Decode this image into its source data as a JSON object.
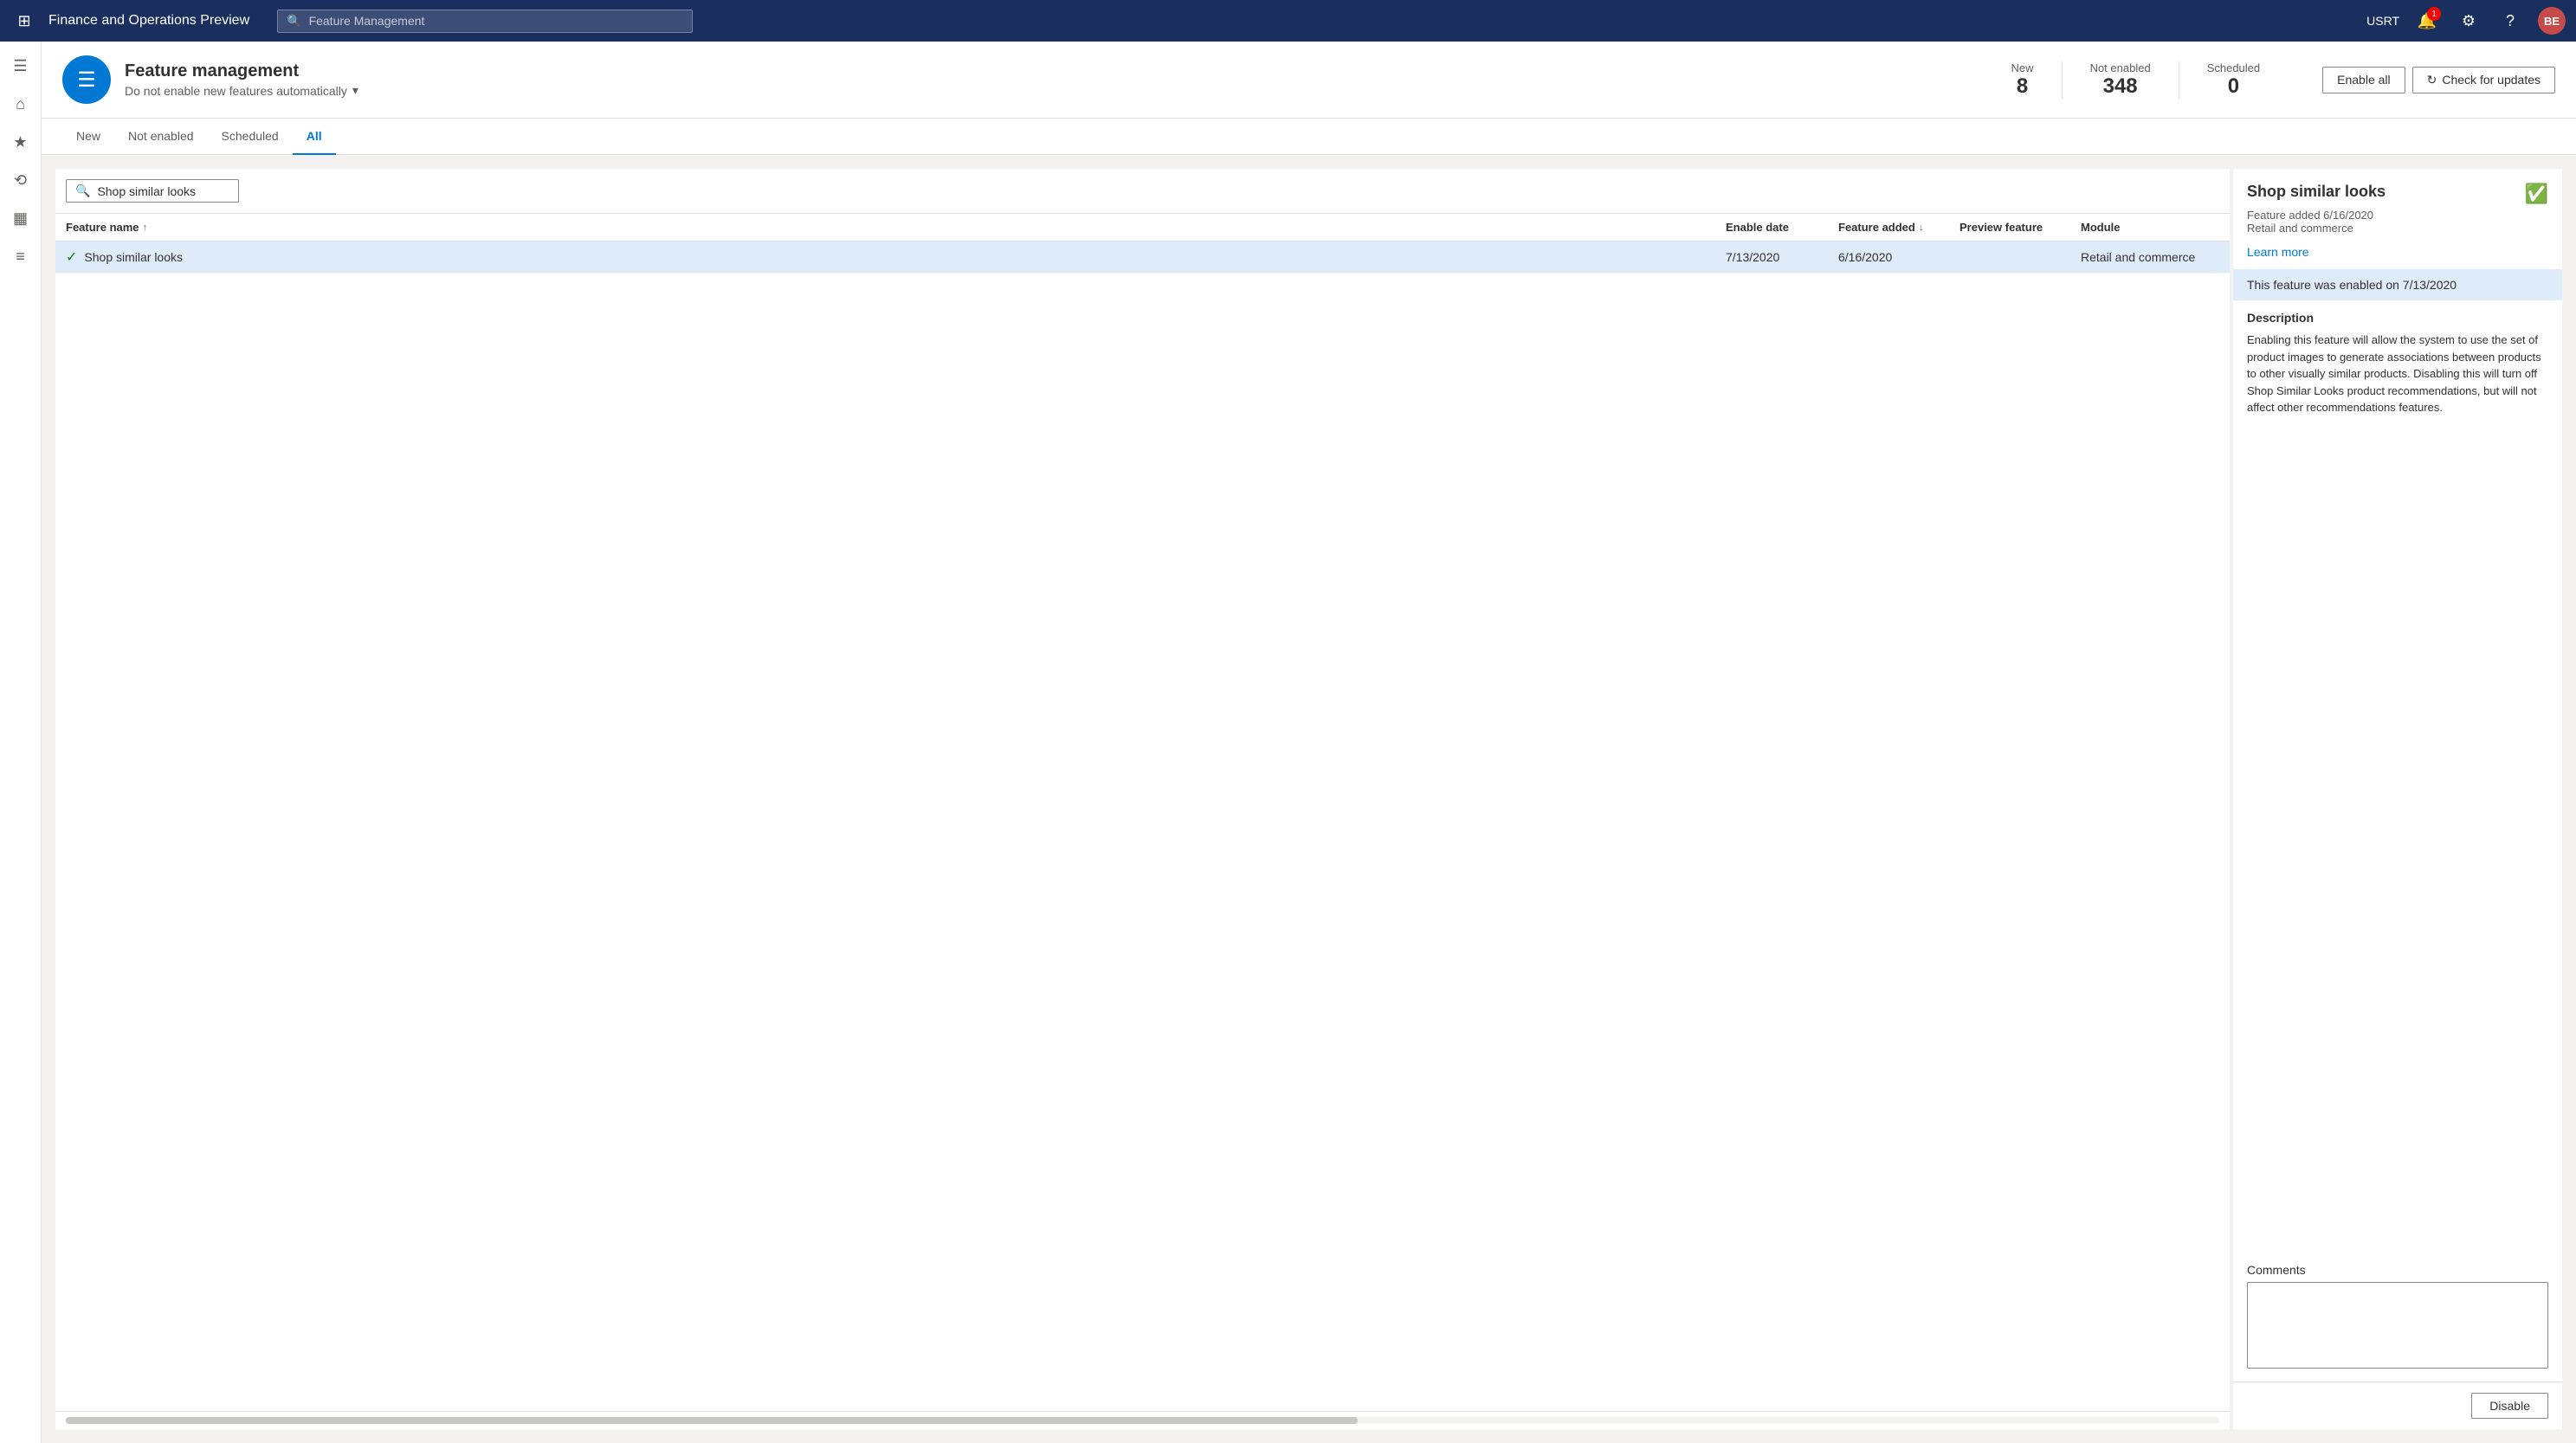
{
  "app": {
    "title": "Finance and Operations Preview",
    "search_placeholder": "Feature Management"
  },
  "topbar": {
    "username": "USRT",
    "notification_count": "1",
    "avatar_initials": "BE"
  },
  "page": {
    "icon_symbol": "☰",
    "title": "Feature management",
    "subtitle": "Do not enable new features automatically",
    "stats": [
      {
        "label": "New",
        "value": "8"
      },
      {
        "label": "Not enabled",
        "value": "348"
      },
      {
        "label": "Scheduled",
        "value": "0"
      }
    ],
    "enable_all_label": "Enable all",
    "check_updates_label": "Check for updates"
  },
  "tabs": [
    {
      "id": "new",
      "label": "New"
    },
    {
      "id": "not_enabled",
      "label": "Not enabled"
    },
    {
      "id": "scheduled",
      "label": "Scheduled"
    },
    {
      "id": "all",
      "label": "All",
      "active": true
    }
  ],
  "feature_list": {
    "search_placeholder": "Shop similar looks",
    "columns": [
      {
        "id": "feature_name",
        "label": "Feature name",
        "sort": "asc"
      },
      {
        "id": "enable_date",
        "label": "Enable date",
        "sort": ""
      },
      {
        "id": "feature_added",
        "label": "Feature added",
        "sort": "desc"
      },
      {
        "id": "preview_feature",
        "label": "Preview feature",
        "sort": ""
      },
      {
        "id": "module",
        "label": "Module",
        "sort": ""
      }
    ],
    "rows": [
      {
        "id": "shop-similar-looks",
        "name": "Shop similar looks",
        "enabled": true,
        "enable_date": "7/13/2020",
        "feature_added": "6/16/2020",
        "preview_feature": "",
        "module": "Retail and commerce",
        "selected": true
      }
    ]
  },
  "detail": {
    "title": "Shop similar looks",
    "enabled_icon": "✓",
    "meta_added": "Feature added 6/16/2020",
    "meta_module": "Retail and commerce",
    "learn_more": "Learn more",
    "enabled_banner": "This feature was enabled on 7/13/2020",
    "description_title": "Description",
    "description_text": "Enabling this feature will allow the system to use the set of product images to generate associations between products to other visually similar products. Disabling this will turn off Shop Similar Looks product recommendations, but will not affect other recommendations features.",
    "comments_label": "Comments",
    "disable_button": "Disable"
  },
  "sidebar": {
    "items": [
      {
        "id": "hamburger",
        "icon": "☰"
      },
      {
        "id": "home",
        "icon": "⌂"
      },
      {
        "id": "favorites",
        "icon": "★"
      },
      {
        "id": "recent",
        "icon": "⟲"
      },
      {
        "id": "workspaces",
        "icon": "▦"
      },
      {
        "id": "list",
        "icon": "≡"
      }
    ]
  }
}
